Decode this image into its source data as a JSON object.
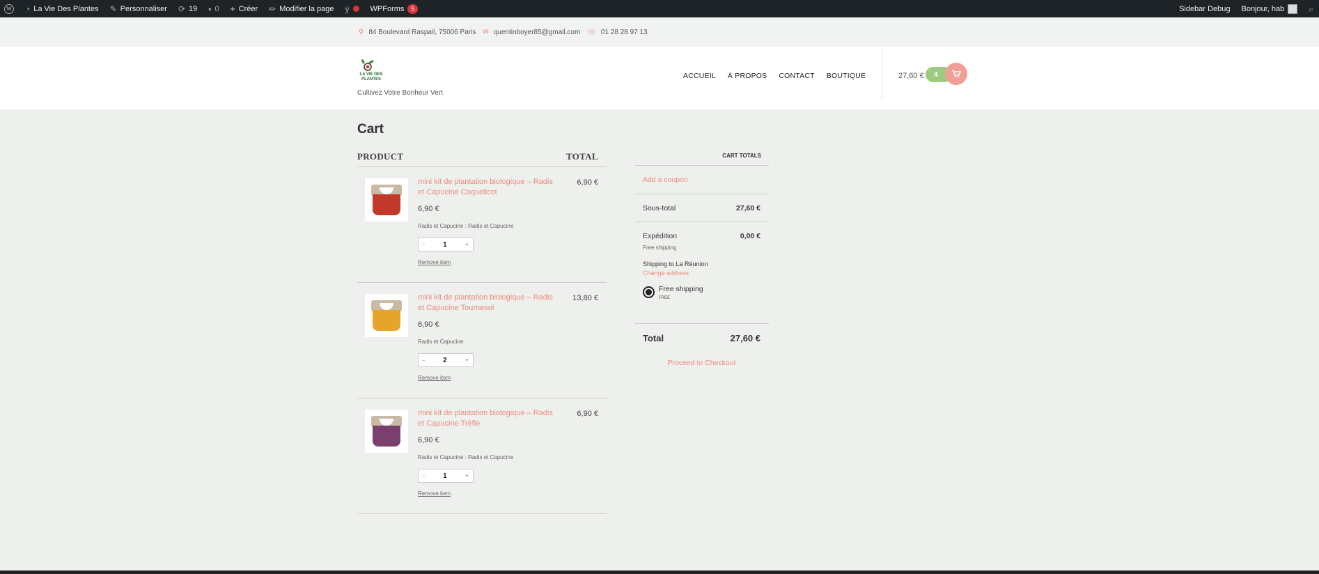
{
  "adminbar": {
    "site_name": "La Vie Des Plantes",
    "customize": "Personnaliser",
    "updates_count": "19",
    "comments_count": "0",
    "new_label": "Créer",
    "edit_page": "Modifier la page",
    "wpforms_label": "WPForms",
    "wpforms_count": "5",
    "sidebar_debug": "Sidebar Debug",
    "greeting": "Bonjour, hab"
  },
  "topbar": {
    "address": "84 Boulevard Raspail, 75006 Paris",
    "email": "quentinboyer85@gmail.com",
    "phone": "01 28 28 97 13"
  },
  "header": {
    "logo_text": "LA VIE DES PLANTES",
    "tagline": "Cultivez Votre Bonheur Vert",
    "nav": [
      "ACCUEIL",
      "À PROPOS",
      "CONTACT",
      "BOUTIQUE"
    ],
    "cart_total": "27,60 €",
    "cart_count": "4"
  },
  "cart": {
    "title": "Cart",
    "col_product": "PRODUCT",
    "col_total": "TOTAL",
    "items": [
      {
        "name": "mini kit de plantation biologique – Radis et Capucine Coquelicot",
        "price": "6,90 €",
        "variant": "Radis et Capucine : Radis et Capucine",
        "qty": "1",
        "total": "6,90 €",
        "remove": "Remove item",
        "color": "#c0392b"
      },
      {
        "name": "mini kit de plantation biologique – Radis et Capucine Tournesol",
        "price": "6,90 €",
        "variant": "Radis et Capucine",
        "qty": "2",
        "total": "13,80 €",
        "remove": "Remove item",
        "color": "#e5a52a"
      },
      {
        "name": "mini kit de plantation biologique – Radis et Capucine Trèfle",
        "price": "6,90 €",
        "variant": "Radis et Capucine : Radis et Capucine",
        "qty": "1",
        "total": "6,90 €",
        "remove": "Remove item",
        "color": "#7b3f6e"
      }
    ],
    "qty_minus": "-",
    "qty_plus": "+"
  },
  "totals": {
    "heading": "CART TOTALS",
    "coupon": "Add a coupon",
    "subtotal_label": "Sous-total",
    "subtotal_value": "27,60 €",
    "shipping_label": "Expédition",
    "shipping_value": "0,00 €",
    "shipping_note": "Free shipping",
    "shipping_to": "Shipping to La Réunion",
    "change_address": "Change address",
    "option_label": "Free shipping",
    "option_price": "FREE",
    "total_label": "Total",
    "total_value": "27,60 €",
    "checkout": "Proceed to Checkout"
  },
  "colors": {
    "accent": "#f0897d",
    "green": "#9ccc7f",
    "adminbar": "#1d2327"
  }
}
